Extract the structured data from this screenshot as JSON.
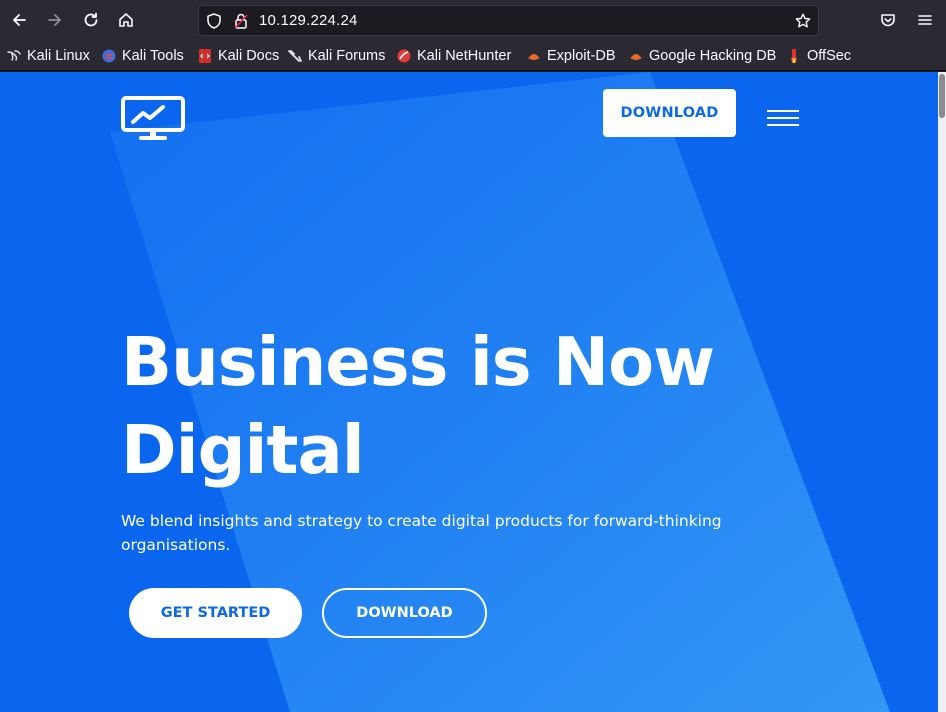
{
  "browser": {
    "url": "10.129.224.24",
    "bookmarks": [
      {
        "label": "Kali Linux",
        "icon": "kali-dragon-icon"
      },
      {
        "label": "Kali Tools",
        "icon": "kali-tools-icon"
      },
      {
        "label": "Kali Docs",
        "icon": "kali-docs-icon"
      },
      {
        "label": "Kali Forums",
        "icon": "kali-forums-icon"
      },
      {
        "label": "Kali NetHunter",
        "icon": "nethunter-icon"
      },
      {
        "label": "Exploit-DB",
        "icon": "exploit-db-icon"
      },
      {
        "label": "Google Hacking DB",
        "icon": "ghdb-icon"
      },
      {
        "label": "OffSec",
        "icon": "offsec-icon"
      }
    ]
  },
  "header": {
    "logo_icon": "monitor-chart-icon",
    "download_label": "DOWNLOAD",
    "menu_icon": "hamburger-menu-icon"
  },
  "hero": {
    "title_line1": "Business is Now",
    "title_line2": "Digital",
    "subtitle": "We blend insights and strategy to create digital products for forward-thinking organisations.",
    "primary_button": "GET STARTED",
    "secondary_button": "DOWNLOAD"
  },
  "colors": {
    "brand_blue": "#0e6cf0",
    "toolbar": "#2b2a33",
    "white": "#ffffff"
  }
}
